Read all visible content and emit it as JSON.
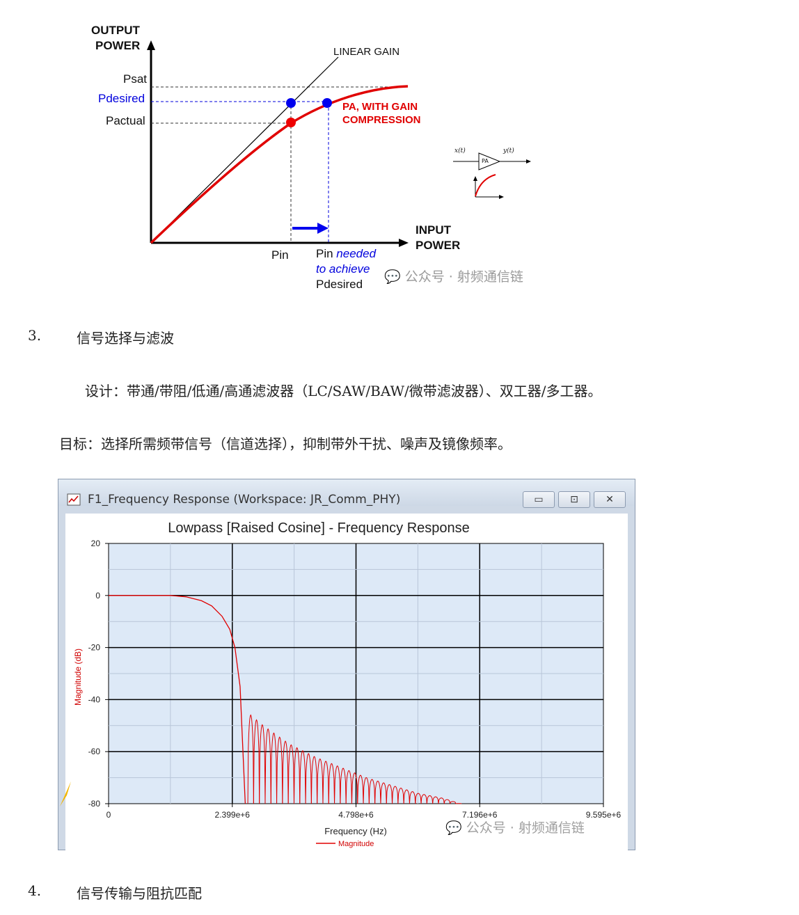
{
  "pa_figure": {
    "y_axis_title_line1": "OUTPUT",
    "y_axis_title_line2": "POWER",
    "x_axis_title_line1": "INPUT",
    "x_axis_title_line2": "POWER",
    "psat": "Psat",
    "pdesired": "Pdesired",
    "pactual": "Pactual",
    "linear_gain": "LINEAR GAIN",
    "pa_curve_line1": "PA, WITH GAIN",
    "pa_curve_line2": "COMPRESSION",
    "pin": "Pin",
    "pin_needed_1": "Pin ",
    "pin_needed_2": "needed",
    "pin_needed_3": "to achieve",
    "pin_needed_4": "Pdesired",
    "inset_in": "x(t)",
    "inset_out": "y(t)",
    "inset_block": "PA",
    "watermark": "公众号 · 射频通信链",
    "colors": {
      "linear": "#000000",
      "pa_curve": "#e00000",
      "desired": "#0000dd"
    }
  },
  "section3": {
    "number": "3.",
    "heading": "信号选择与滤波",
    "design": "设计：带通/带阻/低通/高通滤波器（LC/SAW/BAW/微带滤波器）、双工器/多工器。",
    "goal": "目标：选择所需频带信号（信道选择），抑制带外干扰、噪声及镜像频率。"
  },
  "filter_window": {
    "title": "F1_Frequency Response (Workspace: JR_Comm_PHY)",
    "btn_min": "▭",
    "btn_max": "⊡",
    "btn_close": "✕",
    "watermark": "公众号 · 射频通信链"
  },
  "chart_data": {
    "type": "line",
    "title": "Lowpass [Raised Cosine] - Frequency Response",
    "xlabel": "Frequency (Hz)",
    "ylabel": "Magnitude (dB)",
    "xlim": [
      0,
      9595000
    ],
    "ylim": [
      -80,
      20
    ],
    "x_ticks": [
      "0",
      "2.399e+6",
      "4.798e+6",
      "7.196e+6",
      "9.595e+6"
    ],
    "y_ticks": [
      "20",
      "0",
      "-20",
      "-40",
      "-60",
      "-80"
    ],
    "grid": true,
    "legend": "bottom-center",
    "series": [
      {
        "name": "Magnitude",
        "color": "#e00000",
        "passband": {
          "x": [
            0,
            1200000,
            1500000,
            1800000,
            2000000,
            2200000,
            2350000,
            2450000,
            2550000,
            2650000
          ],
          "y": [
            0,
            0,
            -0.5,
            -2,
            -4,
            -8,
            -13,
            -20,
            -35,
            -80
          ]
        },
        "sidelobe_peaks": {
          "x": [
            2700000,
            3000000,
            3500000,
            4000000,
            4500000,
            5000000,
            5500000,
            6000000,
            6500000,
            6800000
          ],
          "y": [
            -45,
            -50,
            -57,
            -62,
            -66,
            -70,
            -73,
            -76,
            -78,
            -80
          ]
        },
        "notch_depth": -80
      }
    ]
  },
  "section4": {
    "number": "4.",
    "heading": "信号传输与阻抗匹配"
  }
}
